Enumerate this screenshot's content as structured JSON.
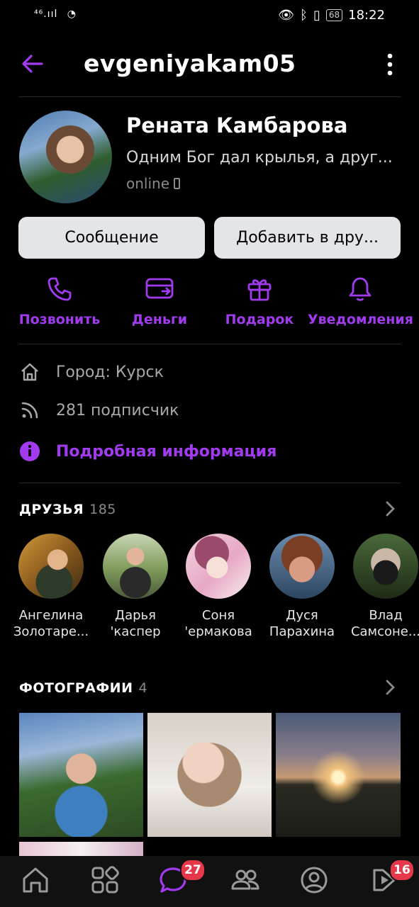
{
  "status_bar": {
    "signal": "⁴⁶.ııl",
    "battery": "68",
    "time": "18:22"
  },
  "header": {
    "username": "evgeniyakam05"
  },
  "profile": {
    "name": "Рената Камбарова",
    "status": "Одним Бог дал крылья, а друг...",
    "online": "online"
  },
  "buttons": {
    "message": "Сообщение",
    "add_friend": "Добавить в дру..."
  },
  "actions": [
    {
      "label": "Позвонить",
      "icon": "phone-icon"
    },
    {
      "label": "Деньги",
      "icon": "money-card-icon"
    },
    {
      "label": "Подарок",
      "icon": "gift-icon"
    },
    {
      "label": "Уведомления",
      "icon": "bell-icon"
    }
  ],
  "info": {
    "city": "Город: Курск",
    "followers": "281 подписчик",
    "details": "Подробная информация"
  },
  "friends": {
    "title": "ДРУЗЬЯ",
    "count": "185",
    "items": [
      {
        "line1": "Ангелина",
        "line2": "Золотаре..."
      },
      {
        "line1": "Дарья",
        "line2": "'каспер"
      },
      {
        "line1": "Соня",
        "line2": "'ермакова"
      },
      {
        "line1": "Дуся",
        "line2": "Парахина"
      },
      {
        "line1": "Влад",
        "line2": "Самсоне..."
      }
    ]
  },
  "photos": {
    "title": "ФОТОГРАФИИ",
    "count": "4"
  },
  "nav": {
    "messages_badge": "27",
    "services_badge": "16"
  },
  "colors": {
    "accent": "#a23bf0",
    "badge": "#e6374b",
    "button_bg": "#e4e5e9",
    "background": "#000000"
  }
}
